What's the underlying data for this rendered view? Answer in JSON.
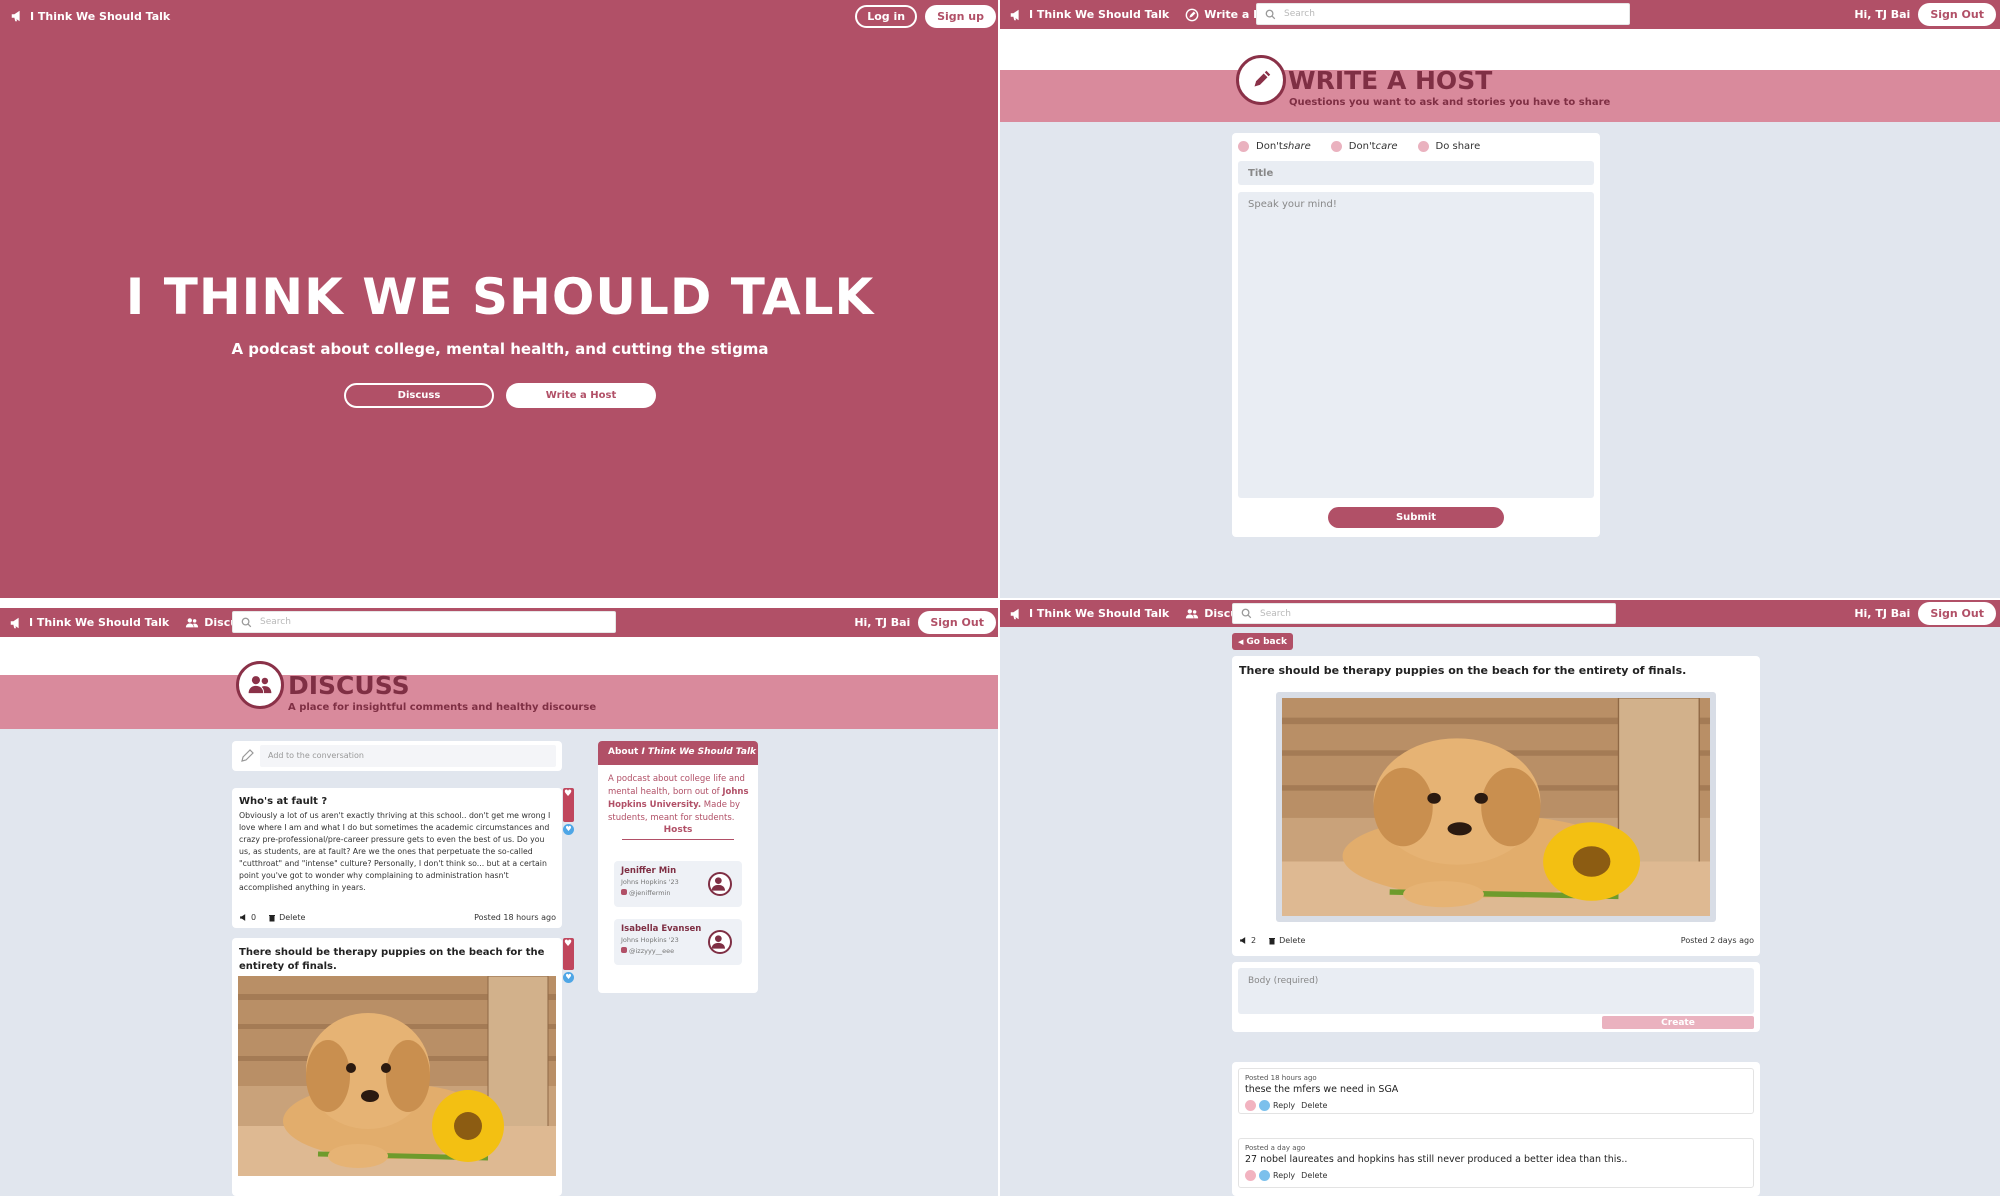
{
  "brand": "I Think We Should Talk",
  "landing": {
    "login": "Log in",
    "signup": "Sign up",
    "title": "I THINK WE SHOULD TALK",
    "subtitle": "A podcast about college, mental health, and cutting the stigma",
    "discuss_btn": "Discuss",
    "write_btn": "Write a Host"
  },
  "write": {
    "nav_menu": "Write a Host",
    "search_placeholder": "Search",
    "greeting": "Hi, TJ Bai",
    "signout": "Sign Out",
    "banner_title": "WRITE A HOST",
    "banner_sub": "Questions you want to ask and stories you have to share",
    "options": [
      {
        "pre": "Don't ",
        "em": "share"
      },
      {
        "pre": "Don't ",
        "em": "care"
      },
      {
        "pre": "Do share",
        "em": ""
      }
    ],
    "title_placeholder": "Title",
    "body_placeholder": "Speak your mind!",
    "submit": "Submit"
  },
  "discuss": {
    "nav_menu": "Discuss",
    "search_placeholder": "Search",
    "greeting": "Hi, TJ Bai",
    "signout": "Sign Out",
    "banner_title": "DISCUSS",
    "banner_sub": "A place for insightful comments and healthy discourse",
    "add_placeholder": "Add to the conversation",
    "post1": {
      "title": "Who's at fault ?",
      "body": "Obviously a lot of us aren't exactly thriving at this school.. don't get me wrong I love where I am and what I do but sometimes the academic circumstances and crazy pre-professional/pre-career pressure gets to even the best of us. Do you us, as students, are at fault? Are we the ones that perpetuate the so-called \"cutthroat\" and \"intense\" culture? Personally, I don't think so... but at a certain point you've got to wonder why complaining to administration hasn't accomplished anything in years.",
      "count": "0",
      "delete": "Delete",
      "posted": "Posted 18 hours ago"
    },
    "post2": {
      "title": "There should be therapy puppies on the beach for the entirety of finals."
    },
    "about": {
      "header_pre": "About ",
      "header_em": "I Think We Should Talk",
      "text_1": "A podcast about college life and mental health, born out of ",
      "text_bold": "Johns Hopkins University.",
      "text_2": " Made by students, meant for students.",
      "hosts_label": "Hosts",
      "hosts": [
        {
          "name": "Jeniffer Min",
          "school": "Johns Hopkins '23",
          "handle": "@jeniffermin"
        },
        {
          "name": "Isabella Evansen",
          "school": "Johns Hopkins '23",
          "handle": "@izzyyy__eee"
        }
      ]
    }
  },
  "detail": {
    "nav_menu": "Discuss",
    "search_placeholder": "Search",
    "greeting": "Hi, TJ Bai",
    "signout": "Sign Out",
    "go_back": "Go back",
    "title": "There should be therapy puppies on the beach for the entirety of finals.",
    "count": "2",
    "delete": "Delete",
    "posted": "Posted 2 days ago",
    "body_placeholder": "Body (required)",
    "create": "Create",
    "comments": [
      {
        "posted": "Posted 18 hours ago",
        "text": "these the mfers we need in SGA",
        "reply": "Reply",
        "delete": "Delete"
      },
      {
        "posted": "Posted a day ago",
        "text": "27 nobel laureates and hopkins has still never produced a better idea than this..",
        "reply": "Reply",
        "delete": "Delete"
      }
    ]
  }
}
